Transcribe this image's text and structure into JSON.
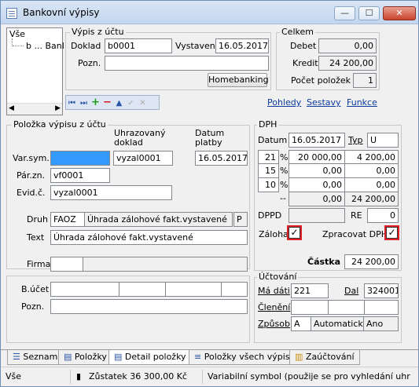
{
  "window": {
    "title": "Bankovní výpisy",
    "min": "—",
    "max": "☐",
    "close": "✕"
  },
  "tree": {
    "root": "Vše",
    "child": "b ... Banl"
  },
  "vypis": {
    "group_title": "Výpis z účtu",
    "doklad_label": "Doklad",
    "doklad_value": "b0001",
    "vystaven_label": "Vystaven",
    "vystaven_value": "16.05.2017",
    "pozn_label": "Pozn.",
    "pozn_value": "",
    "homebanking_label": "Homebanking"
  },
  "celkem": {
    "group_title": "Celkem",
    "debet_label": "Debet",
    "debet_value": "0,00",
    "kredit_label": "Kredit",
    "kredit_value": "24 200,00",
    "pocet_label": "Počet položek",
    "pocet_value": "1"
  },
  "links": {
    "pohledy": "Pohledy",
    "sestavy": "Sestavy",
    "funkce": "Funkce"
  },
  "polozka": {
    "group_title": "Položka výpisu z účtu",
    "uhrazovany_header": "Uhrazovaný\ndoklad",
    "datum_platby_header": "Datum\nplatby",
    "varsym_label": "Var.sym.",
    "varsym_value": "",
    "uhrazovany_value": "vyzal0001",
    "datum_platby_value": "16.05.2017",
    "parzn_label": "Pár.zn.",
    "parzn_value": "vf0001",
    "evidc_label": "Evid.č.",
    "evidc_value": "vyzal0001",
    "druh_label": "Druh",
    "druh_code": "FAOZ",
    "druh_text": "Úhrada zálohové fakt.vystavené",
    "druh_flag": "P",
    "text_label": "Text",
    "text_value": "Úhrada zálohové fakt.vystavené",
    "firma_label": "Firma",
    "bucet_label": "B.účet",
    "pozn_label": "Pozn."
  },
  "dph": {
    "group_title": "DPH",
    "datum_label": "Datum",
    "datum_value": "16.05.2017",
    "typ_label": "Typ",
    "typ_value": "U",
    "rows": [
      {
        "rate": "21",
        "pct": "%",
        "base": "20 000,00",
        "tax": "4 200,00"
      },
      {
        "rate": "15",
        "pct": "%",
        "base": "0,00",
        "tax": "0,00"
      },
      {
        "rate": "10",
        "pct": "%",
        "base": "0,00",
        "tax": "0,00"
      },
      {
        "rate": "",
        "pct": "--",
        "base": "0,00",
        "tax": "24 200,00"
      }
    ],
    "dppd_label": "DPPD",
    "re_label": "RE",
    "re_value": "0",
    "zaloha_label": "Záloha",
    "zaloha_checked": "✓",
    "zpracovat_label": "Zpracovat DPH",
    "zpracovat_checked": "✓",
    "castka_label": "Částka",
    "castka_value": "24 200,00"
  },
  "uctovani": {
    "group_title": "Účtování",
    "madati_label": "Má dáti",
    "madati_value": "221",
    "dal_label": "Dal",
    "dal_value": "324001",
    "cleneni_label": "Členění",
    "zpusob_label": "Způsob",
    "zpusob_a": "A",
    "zpusob_auto": "Automaticky",
    "zpusob_ano": "Ano"
  },
  "tabs": [
    {
      "label": "Seznam"
    },
    {
      "label": "Položky"
    },
    {
      "label": "Detail položky"
    },
    {
      "label": "Položky všech výpisů"
    },
    {
      "label": "Zaúčtování"
    }
  ],
  "status": {
    "left": "Vše",
    "balance": "Zůstatek 36 300,00 Kč",
    "hint": "Variabilní symbol (použije se pro vyhledání uhr"
  },
  "colors": {
    "accent": "#3399ff",
    "highlight_red": "#e21f26",
    "link": "#0a3a9e"
  }
}
